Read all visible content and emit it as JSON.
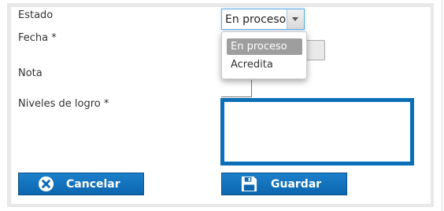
{
  "form": {
    "estado_label": "Estado",
    "fecha_label": "Fecha *",
    "nota_label": "Nota",
    "niveles_label": "Niveles de logro *"
  },
  "estado_select": {
    "value": "En proceso",
    "options": [
      {
        "label": "En proceso",
        "selected": true
      },
      {
        "label": "Acredita",
        "selected": false
      }
    ]
  },
  "niveles_textarea": {
    "value": ""
  },
  "buttons": {
    "cancel_label": "Cancelar",
    "save_label": "Guardar"
  },
  "icons": {
    "cancel": "close-circle-icon",
    "save": "floppy-disk-icon"
  },
  "colors": {
    "button_blue": "#0c6fb8",
    "focus_border": "#0a6fb6",
    "selected_option": "#9e9e9e"
  }
}
